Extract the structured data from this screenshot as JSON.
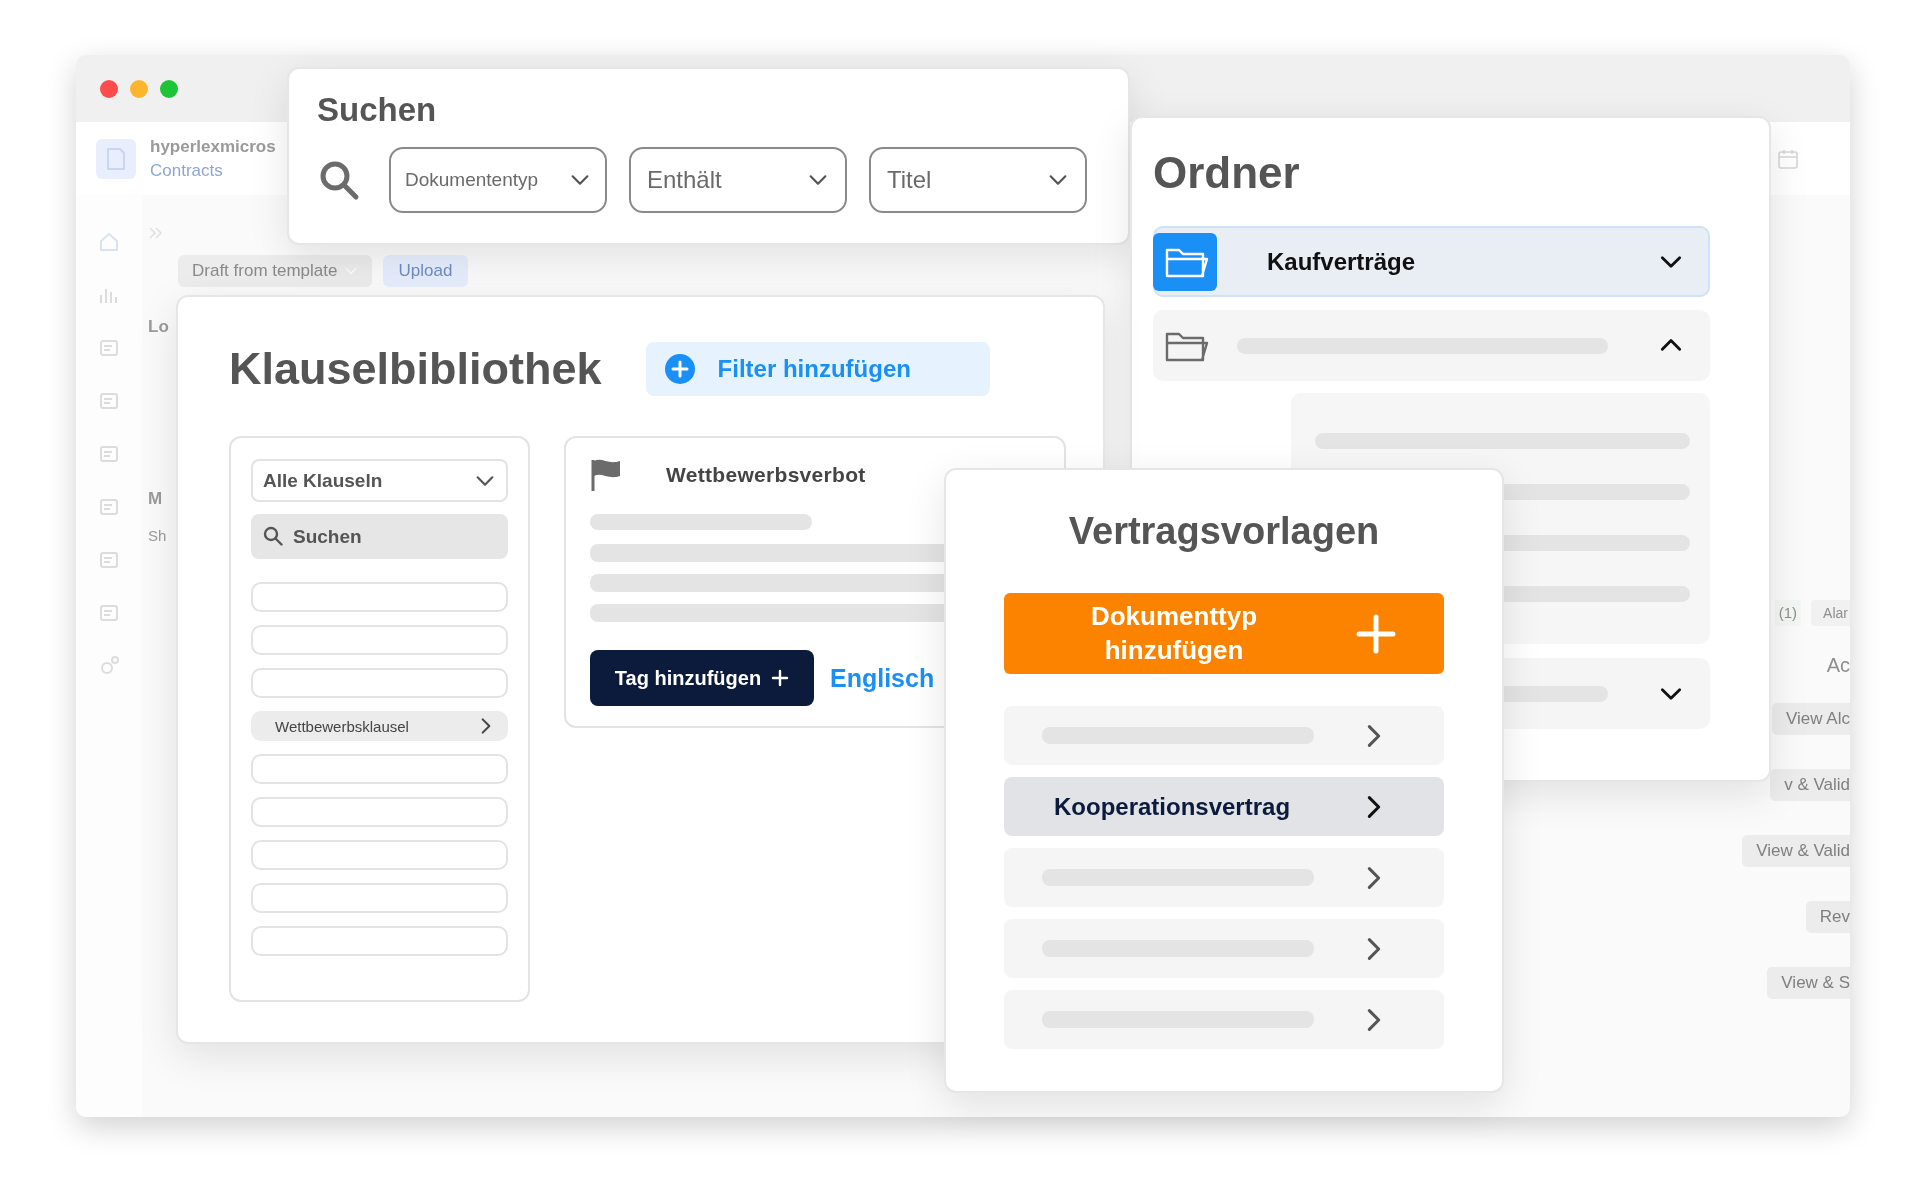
{
  "window": {
    "app_name": "hyperlexmicros",
    "app_section": "Contracts",
    "draft_button": "Draft from template",
    "upload_button": "Upload",
    "main_texts": [
      "Lo",
      "M",
      "Sh"
    ],
    "side_items": [
      {
        "kind": "badge",
        "text": "(1)"
      },
      {
        "kind": "tag",
        "text": "Alar"
      },
      {
        "kind": "heading",
        "text": "Ac"
      },
      {
        "kind": "button",
        "text": "View Alc"
      },
      {
        "kind": "button",
        "text": "v & Valid"
      },
      {
        "kind": "button",
        "text": "View & Valid"
      },
      {
        "kind": "button",
        "text": "Rev"
      },
      {
        "kind": "button",
        "text": "View & S"
      }
    ]
  },
  "search": {
    "title": "Suchen",
    "filters": [
      {
        "value": "Dokumententyp"
      },
      {
        "value": "Enthält"
      },
      {
        "value": "Titel"
      }
    ]
  },
  "folders": {
    "title": "Ordner",
    "items": [
      {
        "label": "Kaufverträge",
        "selected": true,
        "expanded": false
      },
      {
        "selected": false,
        "expanded": true
      },
      {
        "selected": false,
        "expanded": false
      }
    ]
  },
  "clause_library": {
    "title": "Klauselbibliothek",
    "filter_button": "Filter hinzufügen",
    "category": "Alle Klauseln",
    "search": {
      "placeholder": "Suchen"
    },
    "clauses": [
      {
        "selected": false
      },
      {
        "selected": false
      },
      {
        "selected": false
      },
      {
        "label": "Wettbewerbsklausel",
        "selected": true
      },
      {
        "selected": false
      },
      {
        "selected": false
      },
      {
        "selected": false
      },
      {
        "selected": false
      },
      {
        "selected": false
      }
    ],
    "detail": {
      "title": "Wettbewerbsverbot",
      "tag_button": "Tag hinzufügen",
      "language": "Englisch"
    }
  },
  "templates": {
    "title": "Vertragsvorlagen",
    "add_button": "Dokumenttyp hinzufügen",
    "items": [
      {
        "selected": false
      },
      {
        "label": "Kooperationsvertrag",
        "selected": true
      },
      {
        "selected": false
      },
      {
        "selected": false
      },
      {
        "selected": false
      }
    ]
  }
}
